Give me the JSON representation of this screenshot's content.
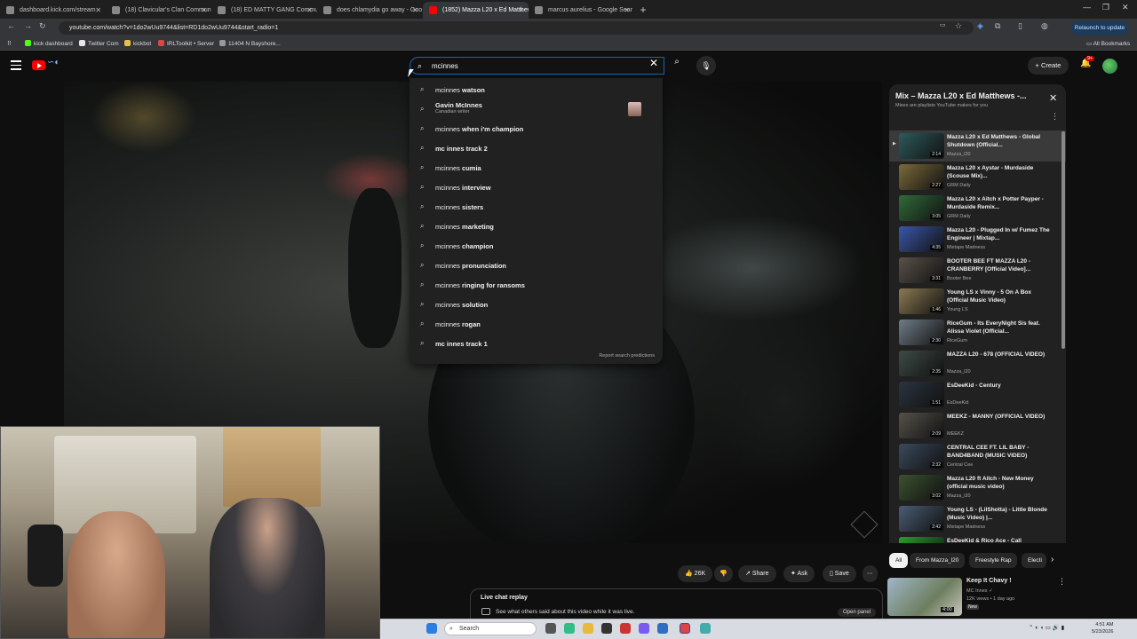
{
  "browser": {
    "tabs": [
      {
        "title": "dashboard.kick.com/stream",
        "active": false
      },
      {
        "title": "(18) Clavicular's Clan Commun",
        "active": false
      },
      {
        "title": "(18) ED MATTY GANG Commu",
        "active": false
      },
      {
        "title": "does chlamydia go away - Goo",
        "active": false
      },
      {
        "title": "(1852) Mazza L20 x Ed Matthew",
        "active": true
      },
      {
        "title": "marcus aurelius - Google Sear",
        "active": false
      }
    ],
    "url": "youtube.com/watch?v=1do2wUu9744&list=RD1do2wUu9744&start_radio=1",
    "relaunch_label": "Relaunch to update",
    "bookmarks": [
      {
        "label": "kick dashboard",
        "color": "#53fc18"
      },
      {
        "label": "Twitter Com",
        "color": "#e7e7e7"
      },
      {
        "label": "kickbot",
        "color": "#e8c14a"
      },
      {
        "label": "IRLToolkit • Server",
        "color": "#d94848"
      },
      {
        "label": "11404 N Bayshore...",
        "color": "#999999"
      }
    ],
    "all_bookmarks_label": "All Bookmarks"
  },
  "youtube": {
    "search_value": "mcinnes",
    "create_label": "Create",
    "notif_count": "9+",
    "suggestions": [
      {
        "prefix": "mcinnes",
        "rest": " watson"
      },
      {
        "prefix": "Gavin McInnes",
        "rest": "",
        "sub": "Canadian writer",
        "thumb": true
      },
      {
        "prefix": "mcinnes",
        "rest": " when i'm champion"
      },
      {
        "prefix": "mc innes track 2",
        "rest": ""
      },
      {
        "prefix": "mcinnes",
        "rest": " cumia"
      },
      {
        "prefix": "mcinnes",
        "rest": " interview"
      },
      {
        "prefix": "mcinnes",
        "rest": " sisters"
      },
      {
        "prefix": "mcinnes",
        "rest": " marketing"
      },
      {
        "prefix": "mcinnes",
        "rest": " champion"
      },
      {
        "prefix": "mcinnes",
        "rest": " pronunciation"
      },
      {
        "prefix": "mcinnes",
        "rest": " ringing for ransoms"
      },
      {
        "prefix": "mcinnes",
        "rest": " solution"
      },
      {
        "prefix": "mcinnes",
        "rest": " rogan"
      },
      {
        "prefix": "mc innes track 1",
        "rest": ""
      }
    ],
    "report_label": "Report search predictions",
    "panel": {
      "title": "Mix – Mazza L20 x Ed Matthews -...",
      "subtitle": "Mixes are playlists YouTube makes for you",
      "items": [
        {
          "title": "Mazza L20 x Ed Matthews - Global Shutdown (Official...",
          "channel": "Mazza_l20",
          "duration": "2:14",
          "color": "#2d5a5c"
        },
        {
          "title": "Mazza L20 x Aystar - Murdaside (Scouse Mix)...",
          "channel": "GRM Daily",
          "duration": "2:27",
          "color": "#7b6a3a"
        },
        {
          "title": "Mazza L20 x Aitch x Potter Payper - Murdaside Remix...",
          "channel": "GRM Daily",
          "duration": "3:05",
          "color": "#2f6b39"
        },
        {
          "title": "Mazza L20 - Plugged In w/ Fumez The Engineer | Mixtap...",
          "channel": "Mixtape Madness",
          "duration": "4:35",
          "color": "#3957a8"
        },
        {
          "title": "BOOTER BEE FT MAZZA L20 - CRANBERRY [Official Video]...",
          "channel": "Booter Bee",
          "duration": "3:31",
          "color": "#5a5149"
        },
        {
          "title": "Young LS x Vinny - 5 On A Box (Official Music Video)",
          "channel": "Young LS",
          "duration": "1:46",
          "color": "#8c7a52"
        },
        {
          "title": "RiceGum - Its EveryNight Sis feat. Alissa Violet (Official...",
          "channel": "RiceGum",
          "duration": "2:30",
          "color": "#6f7d86"
        },
        {
          "title": "MAZZA L20 - 678 (OFFICIAL VIDEO)",
          "channel": "Mazza_l20",
          "duration": "2:35",
          "color": "#3e4b45"
        },
        {
          "title": "EsDeeKid - Century",
          "channel": "EsDeeKid",
          "duration": "1:51",
          "color": "#2b3440"
        },
        {
          "title": "MEEKZ - MANNY (OFFICIAL VIDEO)",
          "channel": "MEEKZ",
          "duration": "2:09",
          "color": "#55524a"
        },
        {
          "title": "CENTRAL CEE FT. LIL BABY - BAND4BAND (MUSIC VIDEO)",
          "channel": "Central Cee",
          "duration": "2:32",
          "color": "#3a4a5c"
        },
        {
          "title": "Mazza L20 ft Aitch - New Money (official music video)",
          "channel": "Mazza_l20",
          "duration": "3:02",
          "color": "#3b5230"
        },
        {
          "title": "Young LS - (LilShotta) - Little Blonde (Music Video) |...",
          "channel": "Mixtape Madness",
          "duration": "2:42",
          "color": "#4a5d74"
        },
        {
          "title": "EsDeeKid & Rico Ace - Call",
          "channel": "",
          "duration": "",
          "color": "#28a02c"
        }
      ]
    },
    "chips": [
      "All",
      "From Mazza_l20",
      "Freestyle Rap",
      "Electi"
    ],
    "actions": {
      "likes": "26K",
      "share": "Share",
      "ask": "Ask",
      "save": "Save"
    },
    "recommended": {
      "title": "Keep It Chavy !",
      "channel": "MC Innes",
      "meta": "12K views • 1 day ago",
      "badge": "New",
      "duration": "4:00"
    },
    "chat": {
      "title": "Live chat replay",
      "desc": "See what others said about this video while it was live.",
      "open_label": "Open panel"
    }
  },
  "taskbar": {
    "search_placeholder": "Search",
    "time": "4:51 AM",
    "date": "5/23/2026"
  }
}
